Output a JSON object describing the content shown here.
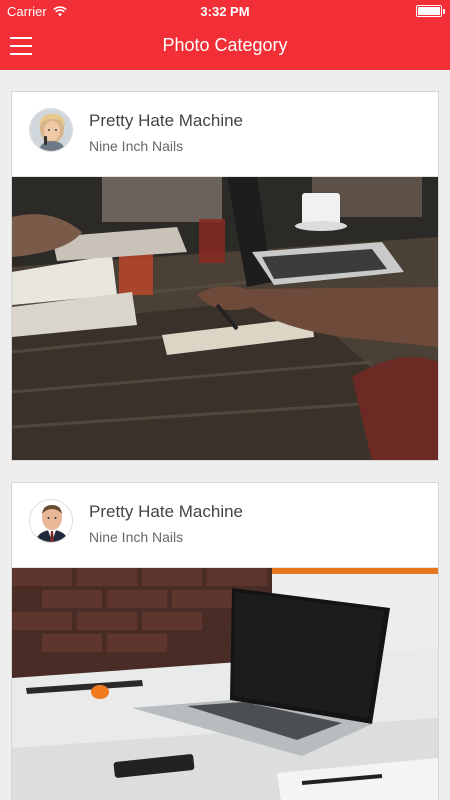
{
  "status": {
    "carrier": "Carrier",
    "time": "3:32 PM",
    "icons": [
      "wifi-icon",
      "battery-icon"
    ]
  },
  "nav": {
    "title": "Photo Category",
    "menu_icon": "hamburger-menu-icon"
  },
  "colors": {
    "accent": "#f22f37",
    "background": "#eeeeee"
  },
  "cards": [
    {
      "title": "Pretty Hate Machine",
      "subtitle": "Nine Inch Nails",
      "avatar": "woman-portrait-avatar",
      "image": "workspace-laptops-table-photo"
    },
    {
      "title": "Pretty Hate Machine",
      "subtitle": "Nine Inch Nails",
      "avatar": "man-portrait-avatar",
      "image": "laptop-on-white-table-photo"
    }
  ]
}
